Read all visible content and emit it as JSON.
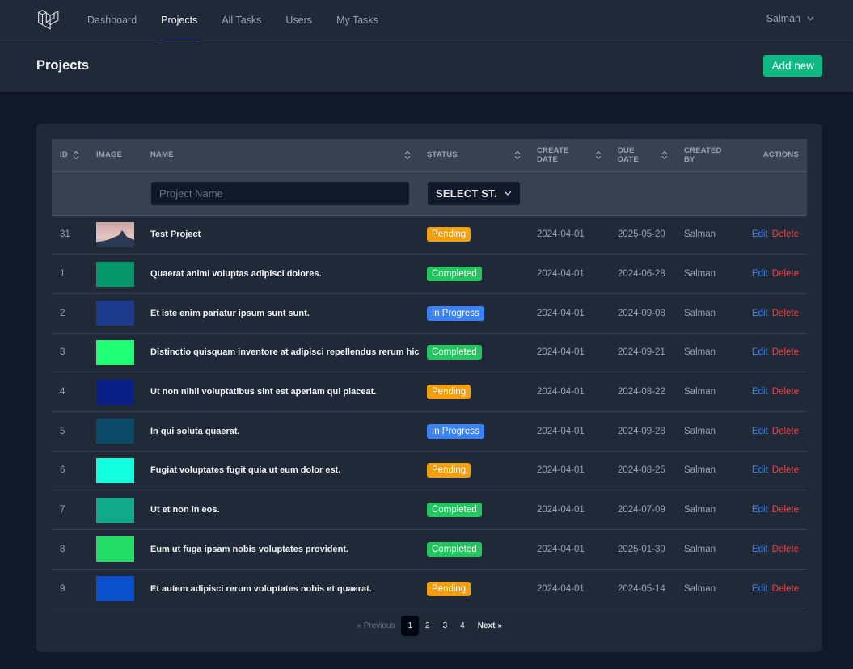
{
  "nav": {
    "links": [
      {
        "label": "Dashboard",
        "active": false
      },
      {
        "label": "Projects",
        "active": true
      },
      {
        "label": "All Tasks",
        "active": false
      },
      {
        "label": "Users",
        "active": false
      },
      {
        "label": "My Tasks",
        "active": false
      }
    ],
    "user": "Salman"
  },
  "header": {
    "title": "Projects",
    "add_label": "Add new"
  },
  "table": {
    "columns": {
      "id": "ID",
      "image": "Image",
      "name": "Name",
      "status": "Status",
      "create_date": "Create Date",
      "due_date": "Due Date",
      "created_by": "Created By",
      "actions": "Actions"
    },
    "filters": {
      "name_placeholder": "Project Name",
      "status_value": "Select Status"
    },
    "edit_label": "Edit",
    "delete_label": "Delete",
    "rows": [
      {
        "id": "31",
        "image": "photo",
        "name": "Test Project",
        "status": "Pending",
        "create": "2024-04-01",
        "due": "2025-05-20",
        "by": "Salman"
      },
      {
        "id": "1",
        "image": "#059669",
        "name": "Quaerat animi voluptas adipisci dolores.",
        "status": "Completed",
        "create": "2024-04-01",
        "due": "2024-06-28",
        "by": "Salman"
      },
      {
        "id": "2",
        "image": "#1e3a8a",
        "name": "Et iste enim pariatur ipsum sunt sunt.",
        "status": "In Progress",
        "create": "2024-04-01",
        "due": "2024-09-08",
        "by": "Salman"
      },
      {
        "id": "3",
        "image": "#22ff77",
        "name": "Distinctio quisquam inventore at adipisci repellendus rerum hic.",
        "status": "Completed",
        "create": "2024-04-01",
        "due": "2024-09-21",
        "by": "Salman"
      },
      {
        "id": "4",
        "image": "#0b1f88",
        "name": "Ut non nihil voluptatibus sint est aperiam qui placeat.",
        "status": "Pending",
        "create": "2024-04-01",
        "due": "2024-08-22",
        "by": "Salman"
      },
      {
        "id": "5",
        "image": "#0a4a66",
        "name": "In qui soluta quaerat.",
        "status": "In Progress",
        "create": "2024-04-01",
        "due": "2024-09-28",
        "by": "Salman"
      },
      {
        "id": "6",
        "image": "#11ffdd",
        "name": "Fugiat voluptates fugit quia ut eum dolor est.",
        "status": "Pending",
        "create": "2024-04-01",
        "due": "2024-08-25",
        "by": "Salman"
      },
      {
        "id": "7",
        "image": "#10aa88",
        "name": "Ut et non in eos.",
        "status": "Completed",
        "create": "2024-04-01",
        "due": "2024-07-09",
        "by": "Salman"
      },
      {
        "id": "8",
        "image": "#22dd66",
        "name": "Eum ut fuga ipsam nobis voluptates provident.",
        "status": "Completed",
        "create": "2024-04-01",
        "due": "2025-01-30",
        "by": "Salman"
      },
      {
        "id": "9",
        "image": "#0a4fcc",
        "name": "Et autem adipisci rerum voluptates nobis et quaerat.",
        "status": "Pending",
        "create": "2024-04-01",
        "due": "2024-05-14",
        "by": "Salman"
      }
    ]
  },
  "status_colors": {
    "Pending": "#f59e0b",
    "Completed": "#22c55e",
    "In Progress": "#3b82f6"
  },
  "pagination": {
    "previous": "« Previous",
    "pages": [
      "1",
      "2",
      "3",
      "4"
    ],
    "current": "1",
    "next": "Next »"
  }
}
